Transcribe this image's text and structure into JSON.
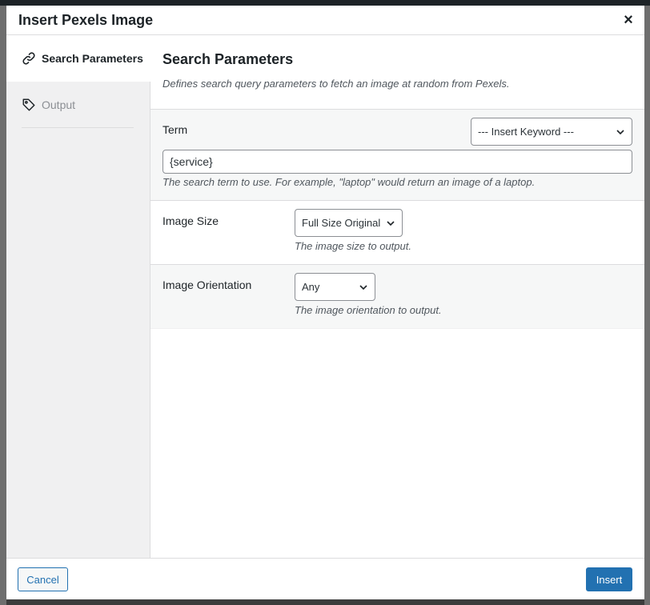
{
  "modal": {
    "title": "Insert Pexels Image",
    "close_symbol": "×"
  },
  "sidebar": {
    "items": [
      {
        "label": "Search Parameters",
        "icon": "link-icon",
        "active": true
      },
      {
        "label": "Output",
        "icon": "tag-icon",
        "active": false
      }
    ]
  },
  "section": {
    "title": "Search Parameters",
    "description": "Defines search query parameters to fetch an image at random from Pexels."
  },
  "fields": {
    "term": {
      "label": "Term",
      "keyword_select": "--- Insert Keyword ---",
      "value": "{service}",
      "help": "The search term to use. For example, \"laptop\" would return an image of a laptop."
    },
    "image_size": {
      "label": "Image Size",
      "selected": "Full Size Original",
      "help": "The image size to output."
    },
    "image_orientation": {
      "label": "Image Orientation",
      "selected": "Any",
      "help": "The image orientation to output."
    }
  },
  "footer": {
    "cancel_label": "Cancel",
    "insert_label": "Insert"
  },
  "colors": {
    "primary": "#2271b1",
    "text": "#1d2327",
    "muted": "#8c8f94",
    "sidebar_bg": "#f0f0f1"
  }
}
